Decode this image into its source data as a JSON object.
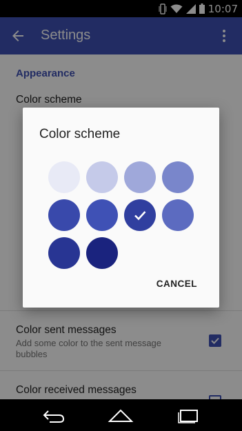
{
  "status_bar": {
    "time": "10:07",
    "icons": [
      "vibrate-icon",
      "wifi-icon",
      "signal-icon",
      "battery-icon"
    ]
  },
  "toolbar": {
    "title": "Settings",
    "back_icon": "arrow-back-icon",
    "menu_icon": "more-vert-icon",
    "color": "#3f51b5"
  },
  "settings": {
    "category": "Appearance",
    "color_scheme_label": "Color scheme",
    "color_sent": {
      "title": "Color sent messages",
      "subtitle": "Add some color to the sent message bubbles",
      "checked": true
    },
    "color_received": {
      "title": "Color received messages",
      "checked": false
    }
  },
  "dialog": {
    "title": "Color scheme",
    "cancel_label": "CANCEL",
    "swatches": [
      {
        "color": "#e8eaf6",
        "selected": false
      },
      {
        "color": "#c5cae9",
        "selected": false
      },
      {
        "color": "#9fa8da",
        "selected": false
      },
      {
        "color": "#7986cb",
        "selected": false
      },
      {
        "color": "#3949ab",
        "selected": false
      },
      {
        "color": "#3f51b5",
        "selected": false
      },
      {
        "color": "#303f9f",
        "selected": true
      },
      {
        "color": "#5c6bc0",
        "selected": false
      },
      {
        "color": "#283593",
        "selected": false
      },
      {
        "color": "#1a237e",
        "selected": false
      }
    ]
  },
  "nav_bar": {
    "icons": [
      "back-nav-icon",
      "home-nav-icon",
      "recents-nav-icon"
    ]
  }
}
